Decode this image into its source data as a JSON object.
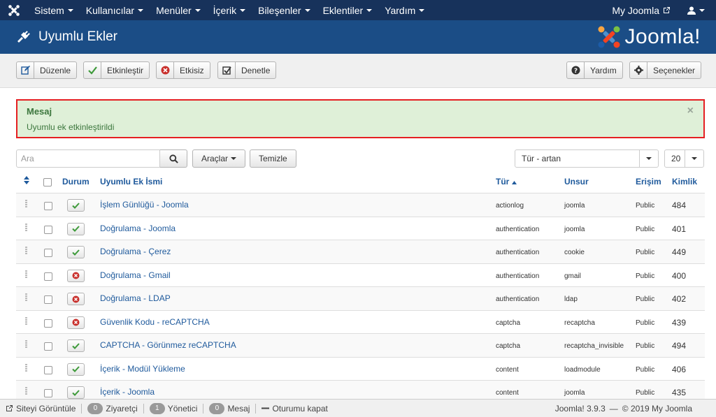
{
  "navbar": {
    "logo_icon": "joomla-logo-icon",
    "menu": [
      {
        "label": "Sistem"
      },
      {
        "label": "Kullanıcılar"
      },
      {
        "label": "Menüler"
      },
      {
        "label": "İçerik"
      },
      {
        "label": "Bileşenler"
      },
      {
        "label": "Eklentiler"
      },
      {
        "label": "Yardım"
      }
    ],
    "site_link": "My Joomla",
    "user_icon": "user-icon"
  },
  "header": {
    "title": "Uyumlu Ekler",
    "brand": "Joomla!"
  },
  "toolbar": {
    "edit": "Düzenle",
    "enable": "Etkinleştir",
    "disable": "Etkisiz",
    "check_in": "Denetle",
    "help": "Yardım",
    "options": "Seçenekler"
  },
  "alert": {
    "title": "Mesaj",
    "message": "Uyumlu ek etkinleştirildi",
    "close": "×"
  },
  "filters": {
    "search_placeholder": "Ara",
    "tools": "Araçlar",
    "clear": "Temizle",
    "sort": "Tür - artan",
    "limit": "20"
  },
  "table": {
    "headers": {
      "status": "Durum",
      "name": "Uyumlu Ek İsmi",
      "type": "Tür",
      "element": "Unsur",
      "access": "Erişim",
      "id": "Kimlik"
    },
    "rows": [
      {
        "enabled": true,
        "name": "İşlem Günlüğü - Joomla",
        "type": "actionlog",
        "element": "joomla",
        "access": "Public",
        "id": "484"
      },
      {
        "enabled": true,
        "name": "Doğrulama - Joomla",
        "type": "authentication",
        "element": "joomla",
        "access": "Public",
        "id": "401"
      },
      {
        "enabled": true,
        "name": "Doğrulama - Çerez",
        "type": "authentication",
        "element": "cookie",
        "access": "Public",
        "id": "449"
      },
      {
        "enabled": false,
        "name": "Doğrulama - Gmail",
        "type": "authentication",
        "element": "gmail",
        "access": "Public",
        "id": "400"
      },
      {
        "enabled": false,
        "name": "Doğrulama - LDAP",
        "type": "authentication",
        "element": "ldap",
        "access": "Public",
        "id": "402"
      },
      {
        "enabled": false,
        "name": "Güvenlik Kodu - reCAPTCHA",
        "type": "captcha",
        "element": "recaptcha",
        "access": "Public",
        "id": "439"
      },
      {
        "enabled": true,
        "name": "CAPTCHA - Görünmez reCAPTCHA",
        "type": "captcha",
        "element": "recaptcha_invisible",
        "access": "Public",
        "id": "494"
      },
      {
        "enabled": true,
        "name": "İçerik - Modül Yükleme",
        "type": "content",
        "element": "loadmodule",
        "access": "Public",
        "id": "406"
      },
      {
        "enabled": true,
        "name": "İçerik - Joomla",
        "type": "content",
        "element": "joomla",
        "access": "Public",
        "id": "435"
      }
    ]
  },
  "statusbar": {
    "view_site": "Siteyi Görüntüle",
    "visitors_count": "0",
    "visitors_label": "Ziyaretçi",
    "admins_count": "1",
    "admins_label": "Yönetici",
    "messages_count": "0",
    "messages_label": "Mesaj",
    "logout": "Oturumu kapat",
    "version": "Joomla! 3.9.3",
    "dash": "—",
    "copyright": "© 2019 My Joomla"
  },
  "colors": {
    "navbar": "#17325b",
    "header": "#1b4d86",
    "link": "#1f5a9c",
    "success": "#3c763d",
    "danger": "#c9302c"
  }
}
